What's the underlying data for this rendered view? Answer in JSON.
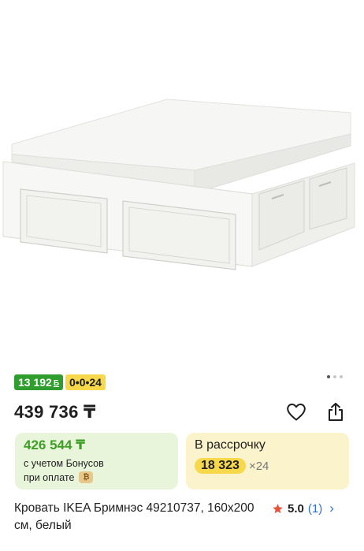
{
  "product": {
    "bonus_badge": "13 192",
    "bonus_badge_symbol": "Б",
    "installment_badge": "0•0•24",
    "price": "439 736 ₸",
    "bonus_price": "426 544 ₸",
    "bonus_note_line1": "с учетом Бонусов",
    "bonus_note_line2": "при оплате",
    "installment_title": "В рассрочку",
    "installment_amount": "18 323",
    "installment_months": "×24",
    "name": "Кровать IKEA Бримнэс 49210737, 160x200 см, белый",
    "rating": "5.0",
    "reviews": "(1)"
  },
  "colors": {
    "bonus_green": "#2f9e2f",
    "installment_yellow": "#f6d84a",
    "link_blue": "#2b6fd1",
    "star_red": "#e8523a"
  },
  "icons": [
    "heart-icon",
    "share-icon",
    "star-icon",
    "chevron-right-icon",
    "coin-icon"
  ],
  "gallery": {
    "dots": 3,
    "active_index": 0
  }
}
